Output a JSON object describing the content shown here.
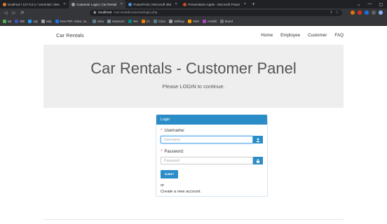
{
  "browser": {
    "tabs": [
      {
        "title": "localhost / 127.0.0.1 / carrental / dete",
        "color": "#e07b39",
        "active": false
      },
      {
        "title": "Customer Login | Car Rental",
        "color": "#9aa0a6",
        "active": true
      },
      {
        "title": "PowerPoint | Microsoft 365",
        "color": "#4a90d9",
        "active": false
      },
      {
        "title": "Presentation Apple - Microsoft Power",
        "color": "#d24726",
        "active": false
      }
    ],
    "new_tab": "+",
    "url_host": "localhost",
    "url_path": "/car-rental/customerlogin.php",
    "bookmarks": [
      {
        "label": "sol",
        "color": "#4caf50"
      },
      {
        "label": "IDE",
        "color": "#3f51b5"
      },
      {
        "label": "sqz",
        "color": "#2196f3"
      },
      {
        "label": "vstp",
        "color": "#9e9e9e"
      },
      {
        "label": "Free PDF, Video, Im...",
        "color": "#1a73e8"
      },
      {
        "label": "cisco",
        "color": "#607d8b"
      },
      {
        "label": "Nasscom",
        "color": "#78909c"
      },
      {
        "label": "Yes",
        "color": "#00897b"
      },
      {
        "label": "Cn",
        "color": "#f57c00"
      },
      {
        "label": "Cisco",
        "color": "#607d8b"
      },
      {
        "label": "Skillsup",
        "color": "#9e9e9e"
      },
      {
        "label": "AWS",
        "color": "#ff9800"
      },
      {
        "label": "mrSkill",
        "color": "#ab47bc"
      },
      {
        "label": "Board",
        "color": "#757575"
      }
    ]
  },
  "nav": {
    "brand": "Car Rentals",
    "links": [
      "Home",
      "Employee",
      "Customer",
      "FAQ"
    ]
  },
  "jumbotron": {
    "title": "Car Rentals - Customer Panel",
    "subtitle": "Please LOGIN to continue."
  },
  "login": {
    "heading": "Login",
    "username_label": "Username:",
    "username_placeholder": "Username",
    "password_label": "Password:",
    "password_placeholder": "Password",
    "required_mark": "*",
    "submit_label": "SUBMIT",
    "or_text": "or",
    "create_text": "Create a new account."
  },
  "colors": {
    "primary": "#2a8dc8",
    "jumbotron_bg": "#eeeeee"
  }
}
